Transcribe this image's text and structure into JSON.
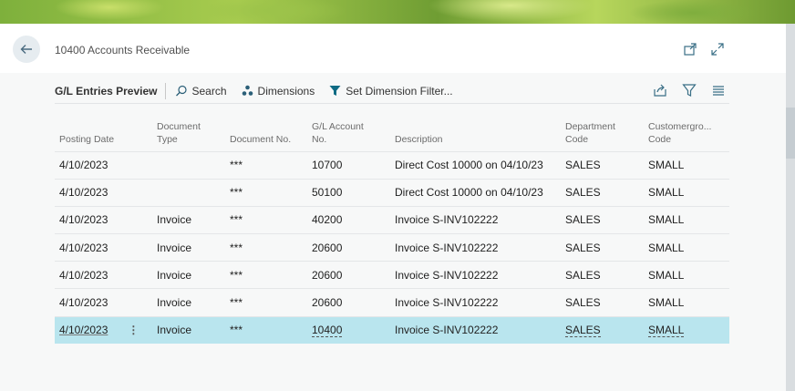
{
  "page": {
    "title": "10400 Accounts Receivable"
  },
  "toolbar": {
    "title": "G/L Entries Preview",
    "search_label": "Search",
    "dimensions_label": "Dimensions",
    "set_dimension_filter_label": "Set Dimension Filter..."
  },
  "table": {
    "headers": {
      "posting_date": "Posting Date",
      "document_type": "Document Type",
      "document_no": "Document No.",
      "gl_account_no": "G/L Account No.",
      "description": "Description",
      "department_code": "Department Code",
      "customergroup_code": "Customergro... Code"
    },
    "rows": [
      {
        "posting_date": "4/10/2023",
        "document_type": "",
        "document_no": "***",
        "gl_account_no": "10700",
        "description": "Direct Cost 10000 on 04/10/23",
        "department_code": "SALES",
        "customergroup_code": "SMALL"
      },
      {
        "posting_date": "4/10/2023",
        "document_type": "",
        "document_no": "***",
        "gl_account_no": "50100",
        "description": "Direct Cost 10000 on 04/10/23",
        "department_code": "SALES",
        "customergroup_code": "SMALL"
      },
      {
        "posting_date": "4/10/2023",
        "document_type": "Invoice",
        "document_no": "***",
        "gl_account_no": "40200",
        "description": "Invoice S-INV102222",
        "department_code": "SALES",
        "customergroup_code": "SMALL"
      },
      {
        "posting_date": "4/10/2023",
        "document_type": "Invoice",
        "document_no": "***",
        "gl_account_no": "20600",
        "description": "Invoice S-INV102222",
        "department_code": "SALES",
        "customergroup_code": "SMALL"
      },
      {
        "posting_date": "4/10/2023",
        "document_type": "Invoice",
        "document_no": "***",
        "gl_account_no": "20600",
        "description": "Invoice S-INV102222",
        "department_code": "SALES",
        "customergroup_code": "SMALL"
      },
      {
        "posting_date": "4/10/2023",
        "document_type": "Invoice",
        "document_no": "***",
        "gl_account_no": "20600",
        "description": "Invoice S-INV102222",
        "department_code": "SALES",
        "customergroup_code": "SMALL"
      },
      {
        "posting_date": "4/10/2023",
        "document_type": "Invoice",
        "document_no": "***",
        "gl_account_no": "10400",
        "description": "Invoice S-INV102222",
        "department_code": "SALES",
        "customergroup_code": "SMALL"
      }
    ],
    "selected_row_index": 6
  },
  "icons": {
    "back": "arrow-left-icon",
    "open_new_window": "open-new-window-icon",
    "expand": "expand-icon",
    "search": "search-icon",
    "dimensions": "dimensions-icon",
    "filter": "filter-icon",
    "share": "share-icon",
    "list_view": "list-view-icon"
  },
  "colors": {
    "accent": "#00838f",
    "selected_row": "#b9e5ee",
    "filter_icon": "#0f6b84"
  }
}
